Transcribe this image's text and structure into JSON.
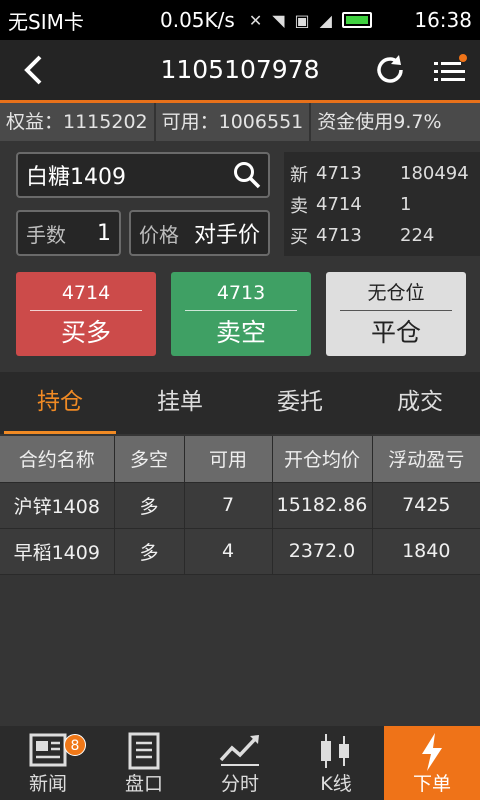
{
  "status": {
    "carrier": "无SIM卡",
    "speed": "0.05K/s",
    "time": "16:38"
  },
  "header": {
    "account": "1105107978"
  },
  "summary": {
    "equity": "权益：1115202",
    "available": "可用：1006551",
    "usage": "资金使用9.7%"
  },
  "order": {
    "contract": "白糖1409",
    "qty_label": "手数",
    "qty_value": "1",
    "price_label": "价格",
    "price_value": "对手价"
  },
  "quotes": [
    {
      "label": "新",
      "price": "4713",
      "vol": "180494"
    },
    {
      "label": "卖",
      "price": "4714",
      "vol": "1"
    },
    {
      "label": "买",
      "price": "4713",
      "vol": "224"
    }
  ],
  "buttons": {
    "buy": {
      "price": "4714",
      "label": "买多"
    },
    "sell": {
      "price": "4713",
      "label": "卖空"
    },
    "close": {
      "price": "无仓位",
      "label": "平仓"
    }
  },
  "tabs": [
    "持仓",
    "挂单",
    "委托",
    "成交"
  ],
  "table": {
    "headers": [
      "合约名称",
      "多空",
      "可用",
      "开仓均价",
      "浮动盈亏"
    ],
    "rows": [
      [
        "沪锌1408",
        "多",
        "7",
        "15182.86",
        "7425"
      ],
      [
        "早稻1409",
        "多",
        "4",
        "2372.0",
        "1840"
      ]
    ]
  },
  "bottom_nav": [
    {
      "label": "新闻",
      "icon": "news-icon",
      "badge": "8"
    },
    {
      "label": "盘口",
      "icon": "orderbook-icon"
    },
    {
      "label": "分时",
      "icon": "timeshare-icon"
    },
    {
      "label": "K线",
      "icon": "kline-icon"
    },
    {
      "label": "下单",
      "icon": "lightning-icon"
    }
  ],
  "colors": {
    "accent": "#ef7318",
    "buy": "#cc4b4a",
    "sell": "#3fa064"
  }
}
